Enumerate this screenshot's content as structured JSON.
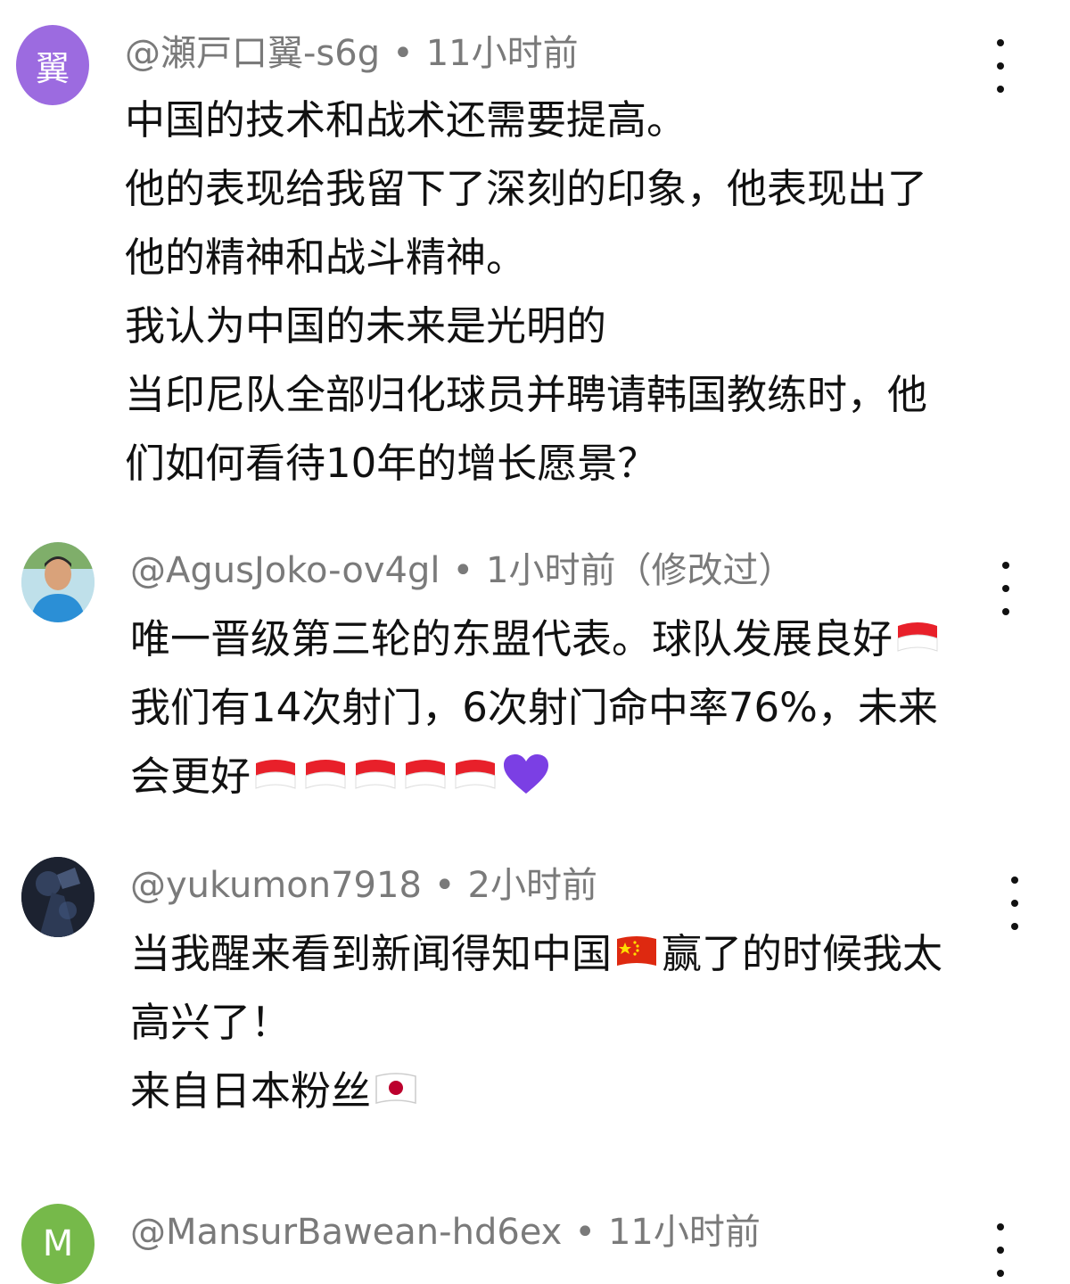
{
  "comments": [
    {
      "avatar_letter": "翼",
      "avatar_color": "#9c6be0",
      "username": "@瀬戸口翼-s6g",
      "separator": "•",
      "time": "11小时前",
      "lines": [
        "中国的技术和战术还需要提高。",
        "他的表现给我留下了深刻的印象，他表现出了",
        "他的精神和战斗精神。",
        "我认为中国的未来是光明的",
        "当印尼队全部归化球员并聘请韩国教练时，他",
        "们如何看待10年的增长愿景？"
      ]
    },
    {
      "avatar_icon": "user-photo",
      "username": "@AgusJoko-ov4gl",
      "separator": "•",
      "time": "1小时前（修改过）",
      "lines": [
        "唯一晋级第三轮的东盟代表。球队发展良好",
        "我们有14次射门，6次射门命中率76%，未来",
        "会更好"
      ],
      "emoji": [
        "indonesia-flag",
        "indonesia-flag",
        "indonesia-flag",
        "indonesia-flag",
        "indonesia-flag",
        "indonesia-flag",
        "purple-heart"
      ]
    },
    {
      "avatar_icon": "dark-game-character",
      "username": "@yukumon7918",
      "separator": "•",
      "time": "2小时前",
      "line1_before_flag": "当我醒来看到新闻得知中国",
      "line1_after_flag": "赢了的时候我太",
      "line2": "高兴了！",
      "line3": "来自日本粉丝",
      "emoji": [
        "china-flag",
        "japan-flag"
      ]
    },
    {
      "avatar_letter": "M",
      "avatar_color": "#76b94a",
      "username": "@MansurBawean-hd6ex",
      "separator": "•",
      "time": "11小时前"
    }
  ],
  "colors": {
    "meta_text": "#7a7a7a",
    "body_text": "#111111",
    "indonesia_red": "#e8202a",
    "china_red": "#de2910",
    "japan_red": "#bc002d",
    "heart": "#7b3fe4"
  }
}
